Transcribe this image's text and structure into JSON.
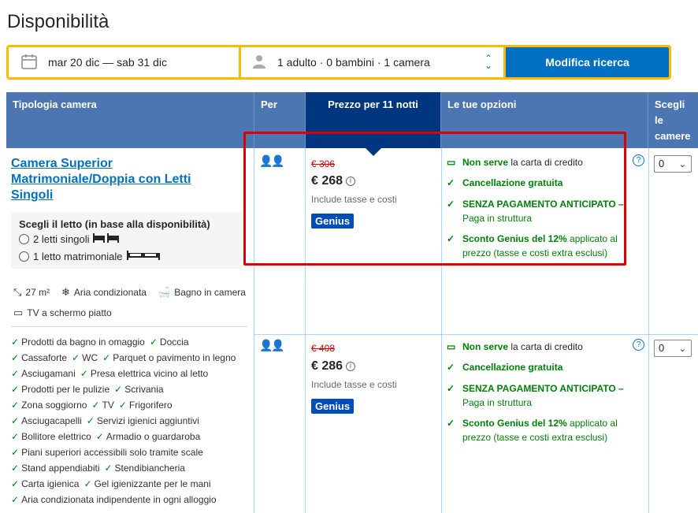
{
  "page_title": "Disponibilità",
  "search": {
    "dates": "mar 20 dic — sab 31 dic",
    "guests": "1 adulto · 0 bambini · 1 camera",
    "button": "Modifica ricerca"
  },
  "table_headers": {
    "room_type": "Tipologia camera",
    "per": "Per",
    "price": "Prezzo per 11 notti",
    "options": "Le tue opzioni",
    "select_rooms": "Scegli le camere"
  },
  "room": {
    "name": "Camera Superior Matrimoniale/Doppia con Letti Singoli",
    "bed_label": "Scegli il letto (in base alla disponibilità)",
    "bed_options": [
      "2 letti singoli",
      "1 letto matrimoniale"
    ],
    "facilities": [
      "27 m²",
      "Aria condizionata",
      "Bagno in camera",
      "TV a schermo piatto"
    ],
    "amenities": [
      "Prodotti da bagno in omaggio",
      "Doccia",
      "Cassaforte",
      "WC",
      "Parquet o pavimento in legno",
      "Asciugamani",
      "Presa elettrica vicino al letto",
      "Prodotti per le pulizie",
      "Scrivania",
      "Zona soggiorno",
      "TV",
      "Frigorifero",
      "Asciugacapelli",
      "Servizi igienici aggiuntivi",
      "Bollitore elettrico",
      "Armadio o guardaroba",
      "Piani superiori accessibili solo tramite scale",
      "Stand appendiabiti",
      "Stendibiancheria",
      "Carta igienica",
      "Gel igienizzante per le mani",
      "Aria condizionata indipendente in ogni alloggio"
    ]
  },
  "offers": [
    {
      "old_price": "€ 306",
      "new_price": "€ 268",
      "taxes": "Include tasse e costi",
      "badge": "Genius",
      "opt1_bold": "Non serve",
      "opt1_rest": " la carta di credito",
      "opt2": "Cancellazione gratuita",
      "opt3_bold": "SENZA PAGAMENTO ANTICIPATO –",
      "opt3_sub": "Paga in struttura",
      "opt4_bold": "Sconto Genius del 12%",
      "opt4_rest": " applicato al prezzo (tasse e costi extra esclusi)",
      "qty": "0"
    },
    {
      "old_price": "€ 408",
      "new_price": "€ 286",
      "taxes": "Include tasse e costi",
      "badge": "Genius",
      "opt1_bold": "Non serve",
      "opt1_rest": " la carta di credito",
      "opt2": "Cancellazione gratuita",
      "opt3_bold": "SENZA PAGAMENTO ANTICIPATO –",
      "opt3_sub": "Paga in struttura",
      "opt4_bold": "Sconto Genius del 12%",
      "opt4_rest": " applicato al prezzo (tasse e costi extra esclusi)",
      "qty": "0"
    }
  ],
  "colors": {
    "accent": "#0071c2",
    "header": "#4c76b2",
    "selected_header": "#003580",
    "highlight": "#e00000",
    "search_border": "#febb02"
  }
}
